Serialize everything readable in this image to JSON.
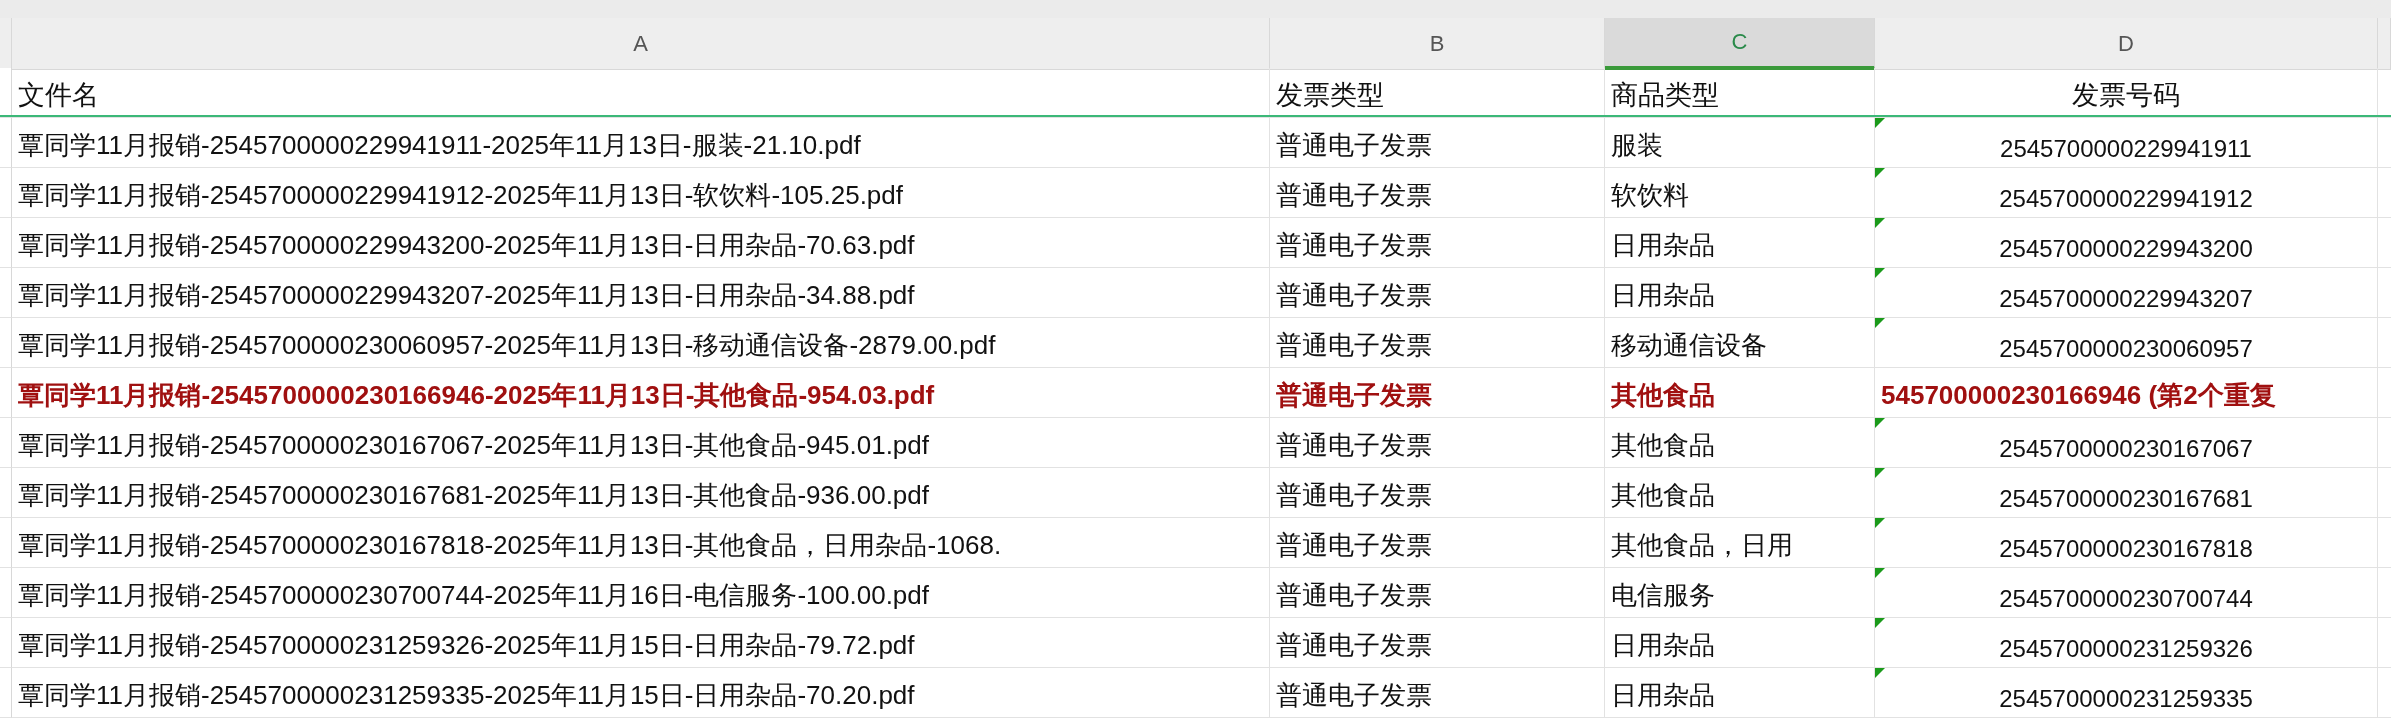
{
  "columns": [
    {
      "letter": "A",
      "selected": false
    },
    {
      "letter": "B",
      "selected": false
    },
    {
      "letter": "C",
      "selected": true
    },
    {
      "letter": "D",
      "selected": false
    }
  ],
  "header_row": [
    "文件名",
    "发票类型",
    "商品类型",
    "发票号码"
  ],
  "rows": [
    {
      "cells": [
        "覃同学11月报销-2545700000229941911-2025年11月13日-服装-21.10.pdf",
        "普通电子发票",
        "服装",
        "2545700000229941911"
      ],
      "highlighted": false,
      "number_stored_as_text": true
    },
    {
      "cells": [
        "覃同学11月报销-2545700000229941912-2025年11月13日-软饮料-105.25.pdf",
        "普通电子发票",
        "软饮料",
        "2545700000229941912"
      ],
      "highlighted": false,
      "number_stored_as_text": true
    },
    {
      "cells": [
        "覃同学11月报销-2545700000229943200-2025年11月13日-日用杂品-70.63.pdf",
        "普通电子发票",
        "日用杂品",
        "2545700000229943200"
      ],
      "highlighted": false,
      "number_stored_as_text": true
    },
    {
      "cells": [
        "覃同学11月报销-2545700000229943207-2025年11月13日-日用杂品-34.88.pdf",
        "普通电子发票",
        "日用杂品",
        "2545700000229943207"
      ],
      "highlighted": false,
      "number_stored_as_text": true
    },
    {
      "cells": [
        "覃同学11月报销-2545700000230060957-2025年11月13日-移动通信设备-2879.00.pdf",
        "普通电子发票",
        "移动通信设备",
        "2545700000230060957"
      ],
      "highlighted": false,
      "number_stored_as_text": true
    },
    {
      "cells": [
        "覃同学11月报销-2545700000230166946-2025年11月13日-其他食品-954.03.pdf",
        "普通电子发票",
        "其他食品",
        "545700000230166946 (第2个重复"
      ],
      "highlighted": true,
      "number_stored_as_text": false
    },
    {
      "cells": [
        "覃同学11月报销-2545700000230167067-2025年11月13日-其他食品-945.01.pdf",
        "普通电子发票",
        "其他食品",
        "2545700000230167067"
      ],
      "highlighted": false,
      "number_stored_as_text": true
    },
    {
      "cells": [
        "覃同学11月报销-2545700000230167681-2025年11月13日-其他食品-936.00.pdf",
        "普通电子发票",
        "其他食品",
        "2545700000230167681"
      ],
      "highlighted": false,
      "number_stored_as_text": true
    },
    {
      "cells": [
        "覃同学11月报销-2545700000230167818-2025年11月13日-其他食品，日用杂品-1068.",
        "普通电子发票",
        "其他食品，日用",
        "2545700000230167818"
      ],
      "highlighted": false,
      "number_stored_as_text": true
    },
    {
      "cells": [
        "覃同学11月报销-2545700000230700744-2025年11月16日-电信服务-100.00.pdf",
        "普通电子发票",
        "电信服务",
        "2545700000230700744"
      ],
      "highlighted": false,
      "number_stored_as_text": true
    },
    {
      "cells": [
        "覃同学11月报销-2545700000231259326-2025年11月15日-日用杂品-79.72.pdf",
        "普通电子发票",
        "日用杂品",
        "2545700000231259326"
      ],
      "highlighted": false,
      "number_stored_as_text": true
    },
    {
      "cells": [
        "覃同学11月报销-2545700000231259335-2025年11月15日-日用杂品-70.20.pdf",
        "普通电子发票",
        "日用杂品",
        "2545700000231259335"
      ],
      "highlighted": false,
      "number_stored_as_text": true
    }
  ]
}
